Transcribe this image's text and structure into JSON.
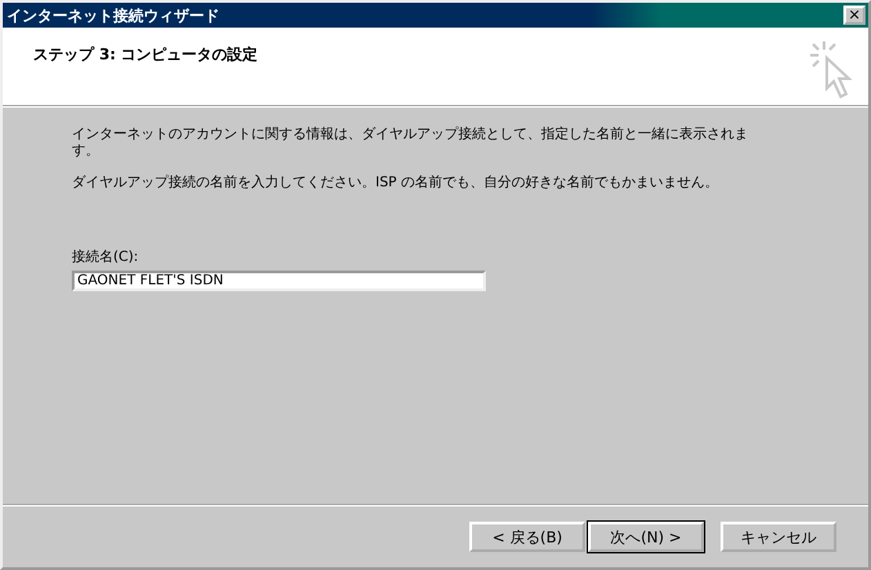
{
  "window": {
    "title": "インターネット接続ウィザード",
    "close": "×"
  },
  "header": {
    "title": "ステップ 3: コンピュータの設定"
  },
  "body": {
    "paragraphs": [
      "インターネットのアカウントに関する情報は、ダイヤルアップ接続として、指定した名前と一緒に表示されます。",
      "ダイヤルアップ接続の名前を入力してください。ISP の名前でも、自分の好きな名前でもかまいません。"
    ],
    "field": {
      "label": "接続名(C):",
      "value": "GAONET FLET'S ISDN"
    }
  },
  "buttons": [
    {
      "label": "< 戻る(B)",
      "default": false
    },
    {
      "label": "次へ(N) >",
      "default": true
    },
    {
      "label": "キャンセル",
      "default": false
    }
  ]
}
